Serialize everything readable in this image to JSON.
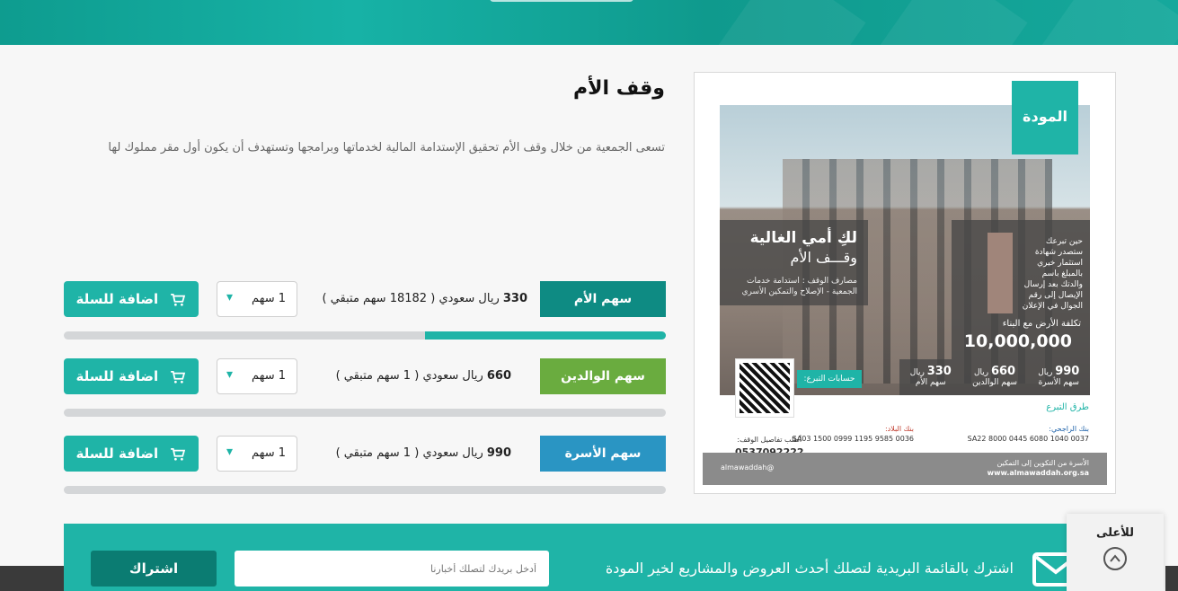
{
  "page": {
    "title": "وقف الأم",
    "description": "تسعى الجمعية من خلال وقف الأم تحقيق الإستدامة المالية لخدماتها وبرامجها وتستهدف أن يكون أول مقر مملوك لها"
  },
  "shares": [
    {
      "label": "سهم الأم",
      "color": "#0e8b83",
      "price": "330",
      "currency": "ريال سعودي",
      "remaining": "( 18182 سهم متبقي )",
      "quantity": "1 سهم",
      "add_label": "اضافة للسلة",
      "progress": 0.4
    },
    {
      "label": "سهم الوالدين",
      "color": "#6aac3f",
      "price": "660",
      "currency": "ريال سعودي",
      "remaining": "( 1 سهم متبقي )",
      "quantity": "1 سهم",
      "add_label": "اضافة للسلة",
      "progress": 0
    },
    {
      "label": "سهم الأسرة",
      "color": "#2a95c3",
      "price": "990",
      "currency": "ريال سعودي",
      "remaining": "( 1 سهم متبقي )",
      "quantity": "1 سهم",
      "add_label": "اضافة للسلة",
      "progress": 0
    }
  ],
  "poster": {
    "logo": "المودة",
    "headline": "لكِ أمي الغالية",
    "subheadline": "وقـــف الأم",
    "desc": "مصارف الوقف : استدامة خدمات الجمعية - الإصلاح والتمكين الأسري",
    "right_text": "حين تبرعك ستصدر شهادة استثمار خيري بالمبلغ باسم والدتك بعد إرسال الإيصال إلى رقم الجوال في الإعلان",
    "cost_label": "تكلفة الأرض مع البناء",
    "cost": "10,000,000",
    "prices": [
      {
        "value": "990",
        "unit": "ريال",
        "name": "سهم الأسرة"
      },
      {
        "value": "660",
        "unit": "ريال",
        "name": "سهم الوالدين"
      },
      {
        "value": "330",
        "unit": "ريال",
        "name": "سهم الأم"
      }
    ],
    "accounts_btn": "حسابات التبرع:",
    "methods": "طرق التبرع",
    "details_label": "أطلب تفاصيل الوقف:",
    "phone": "0537092222",
    "bank1_name": "بنك الراجحي:",
    "bank1_iban": "SA22 8000 0445 6080 1040 0037",
    "bank2_name": "بنك البلاد:",
    "bank2_iban": "SA03 1500 0999 1195 9585 0036",
    "footer_handle": "@almawaddah",
    "footer_tagline": "الأسرة من التكوين إلى التمكين",
    "footer_site": "www.almawaddah.org.sa"
  },
  "newsletter": {
    "text": "اشترك بالقائمة البريدية لتصلك أحدث العروض والمشاريع لخير المودة",
    "placeholder": "أدخل بريدك لتصلك أخبارنا",
    "button": "اشتراك"
  },
  "to_top": {
    "label": "للأعلى"
  },
  "colors": {
    "accent": "#1fb4a7",
    "dark_accent": "#0b7c72"
  }
}
